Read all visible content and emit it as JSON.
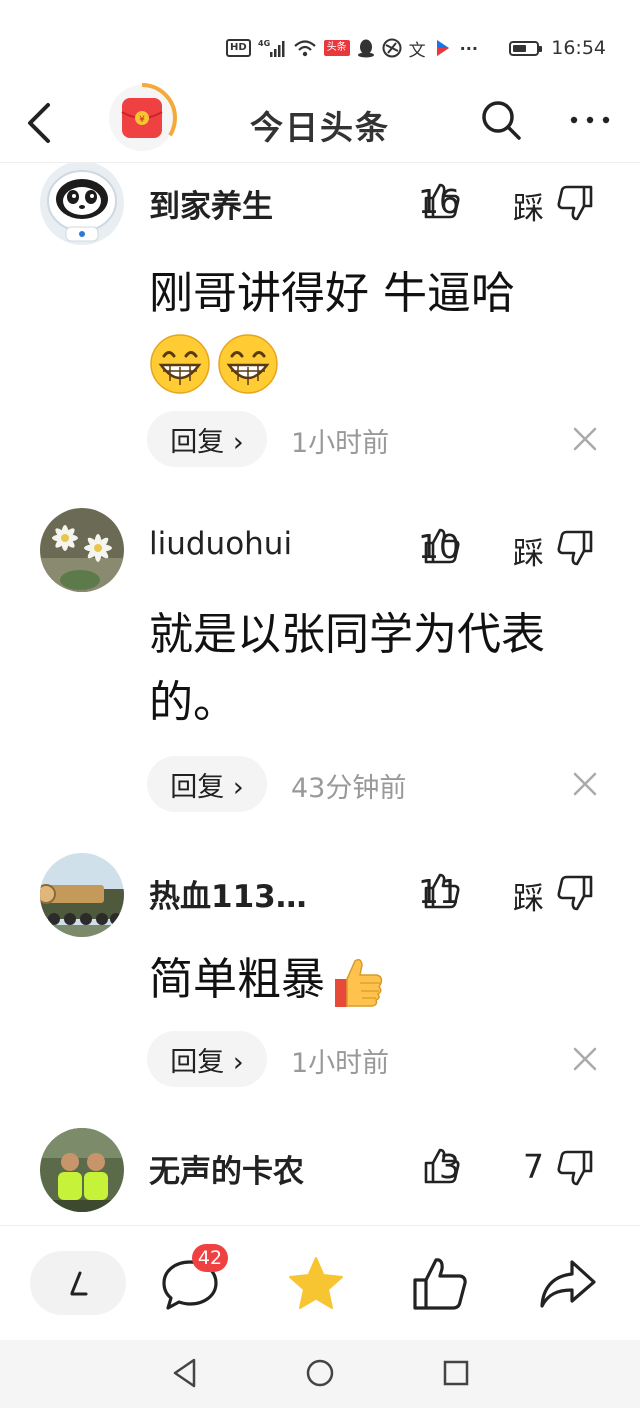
{
  "status_bar": {
    "hd": "HD",
    "network": "4G",
    "toutiao_badge": "头条",
    "wen_icon": "文",
    "more_dots": "···",
    "time": "16:54",
    "icons": [
      "hd-icon",
      "signal-icon",
      "wifi-icon",
      "toutiao-icon",
      "qq-icon",
      "app-icon",
      "wen-icon",
      "video-app-icon",
      "battery-icon"
    ]
  },
  "header": {
    "title": "今日头条",
    "icons": [
      "back-icon",
      "red-packet-icon",
      "search-icon",
      "more-icon"
    ]
  },
  "comments": [
    {
      "username": "到家养生",
      "likes": "16",
      "dislike_label": "踩",
      "text": "刚哥讲得好 牛逼哈",
      "emojis": [
        "grin",
        "grin"
      ],
      "reply_label": "回复 ›",
      "time": "1小时前"
    },
    {
      "username": "liuduohui",
      "likes": "10",
      "dislike_label": "踩",
      "text": "就是以张同学为代表的。",
      "reply_label": "回复 ›",
      "time": "43分钟前"
    },
    {
      "username": "热血113…",
      "likes": "11",
      "dislike_label": "踩",
      "text": "简单粗暴",
      "emojis": [
        "thumbs-up"
      ],
      "reply_label": "回复 ›",
      "time": "1小时前"
    },
    {
      "username": "无声的卡农",
      "likes": "3",
      "dislike_label": "7"
    }
  ],
  "bottom_bar": {
    "comment_count": "42",
    "icons": [
      "write-icon",
      "comment-icon",
      "star-icon",
      "like-icon",
      "share-icon"
    ]
  },
  "system_nav": {
    "icons": [
      "back-triangle-icon",
      "home-circle-icon",
      "recent-square-icon"
    ]
  },
  "colors": {
    "accent_red": "#f04142",
    "star_yellow": "#f7c531",
    "text": "#222222",
    "secondary_text": "#999999"
  }
}
